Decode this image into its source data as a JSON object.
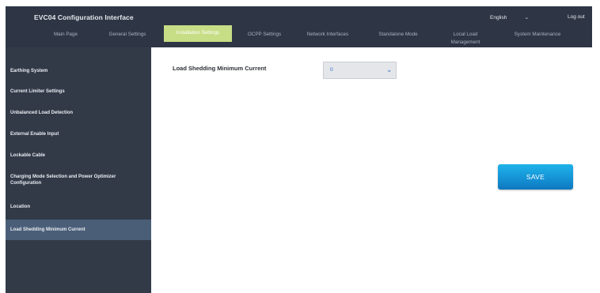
{
  "header": {
    "app_title": "EVC04 Configuration Interface",
    "language": "English",
    "language_chevron": "chevron-down-icon",
    "logout_label": "Log out"
  },
  "nav": {
    "items": [
      {
        "label": "Main Page",
        "active": false
      },
      {
        "label": "General Settings",
        "active": false
      },
      {
        "label": "Installation Settings",
        "active": true
      },
      {
        "label": "OCPP Settings",
        "active": false
      },
      {
        "label": "Network Interfaces",
        "active": false
      },
      {
        "label": "Standalone Mode",
        "active": false
      },
      {
        "label": "Local Load Management",
        "active": false
      },
      {
        "label": "System Maintenance",
        "active": false
      }
    ]
  },
  "sidebar": {
    "items": [
      {
        "label": "Earthing System",
        "active": false
      },
      {
        "label": "Current Limiter Settings",
        "active": false
      },
      {
        "label": "Unbalanced Load Detection",
        "active": false
      },
      {
        "label": "External Enable Input",
        "active": false
      },
      {
        "label": "Lockable Cable",
        "active": false
      },
      {
        "label": "Charging Mode Selection and Power Optimizer Configuration",
        "active": false
      },
      {
        "label": "Location",
        "active": false
      },
      {
        "label": "Load Shedding Minimum Current",
        "active": true
      }
    ]
  },
  "main": {
    "field_label": "Load Shedding Minimum Current",
    "select_value": "0",
    "save_label": "SAVE"
  },
  "colors": {
    "header_bg": "#2e3645",
    "sidebar_bg": "#323a48",
    "active_nav": "#c7dd86",
    "active_sidebar": "#4a5e78",
    "save_button": "#1593d6"
  }
}
